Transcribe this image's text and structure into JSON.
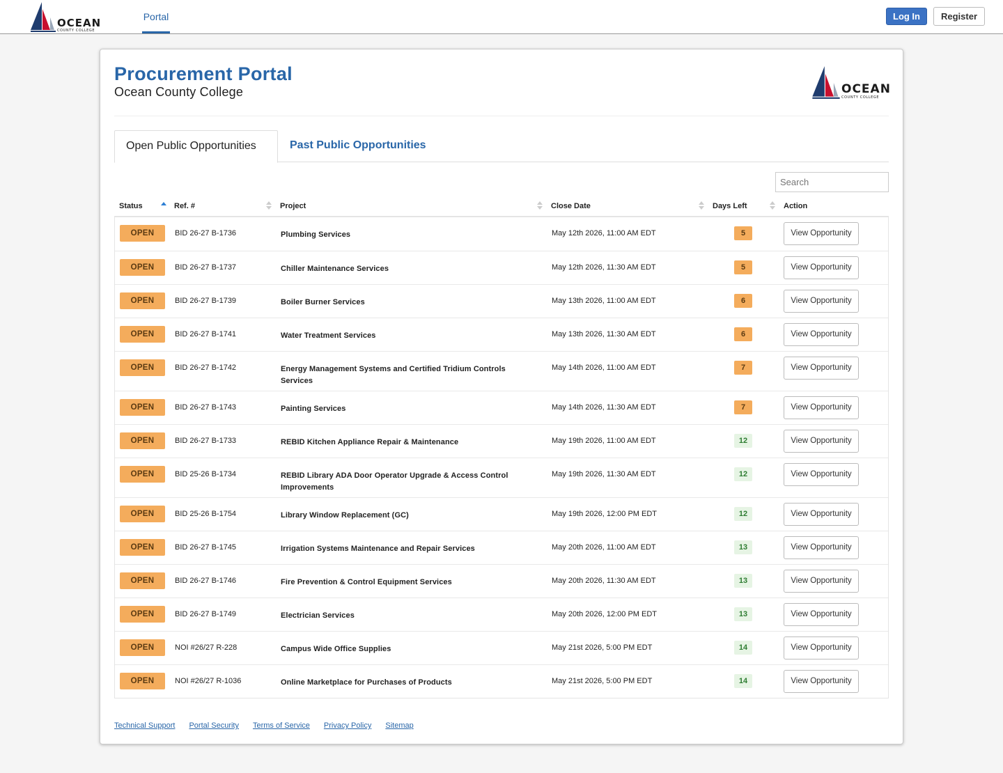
{
  "nav": {
    "logo": {
      "word": "OCEAN",
      "sub": "COUNTY COLLEGE"
    },
    "tab": "Portal",
    "login_label": "Log In",
    "register_label": "Register"
  },
  "header": {
    "title": "Procurement Portal",
    "subtitle": "Ocean County College",
    "logo": {
      "word": "OCEAN",
      "sub": "COUNTY COLLEGE"
    }
  },
  "tabs": [
    "Open Public Opportunities",
    "Past Public Opportunities"
  ],
  "search": {
    "placeholder": "Search"
  },
  "table": {
    "columns": [
      "Status",
      "Ref. #",
      "Project",
      "Close Date",
      "Days Left",
      "Action"
    ],
    "rows": [
      {
        "status": "OPEN",
        "ref": "BID 26-27 B-1736",
        "project": "Plumbing Services",
        "close": "May 12th 2026, 11:00 AM EDT",
        "days": "5",
        "tone": "orange",
        "action": "View Opportunity"
      },
      {
        "status": "OPEN",
        "ref": "BID 26-27 B-1737",
        "project": "Chiller Maintenance Services",
        "close": "May 12th 2026, 11:30 AM EDT",
        "days": "5",
        "tone": "orange",
        "action": "View Opportunity"
      },
      {
        "status": "OPEN",
        "ref": "BID 26-27 B-1739",
        "project": "Boiler Burner Services",
        "close": "May 13th 2026, 11:00 AM EDT",
        "days": "6",
        "tone": "orange",
        "action": "View Opportunity"
      },
      {
        "status": "OPEN",
        "ref": "BID 26-27 B-1741",
        "project": "Water Treatment Services",
        "close": "May 13th 2026, 11:30 AM EDT",
        "days": "6",
        "tone": "orange",
        "action": "View Opportunity"
      },
      {
        "status": "OPEN",
        "ref": "BID 26-27 B-1742",
        "project": "Energy Management Systems and Certified Tridium Controls Services",
        "close": "May 14th 2026, 11:00 AM EDT",
        "days": "7",
        "tone": "orange",
        "action": "View Opportunity",
        "tall": true
      },
      {
        "status": "OPEN",
        "ref": "BID 26-27 B-1743",
        "project": "Painting Services",
        "close": "May 14th 2026, 11:30 AM EDT",
        "days": "7",
        "tone": "orange",
        "action": "View Opportunity"
      },
      {
        "status": "OPEN",
        "ref": "BID 26-27 B-1733",
        "project": "REBID Kitchen Appliance Repair & Maintenance",
        "close": "May 19th 2026, 11:00 AM EDT",
        "days": "12",
        "tone": "green",
        "action": "View Opportunity"
      },
      {
        "status": "OPEN",
        "ref": "BID 25-26 B-1734",
        "project": "REBID Library ADA Door Operator Upgrade & Access Control Improvements",
        "close": "May 19th 2026, 11:30 AM EDT",
        "days": "12",
        "tone": "green",
        "action": "View Opportunity",
        "tall": true
      },
      {
        "status": "OPEN",
        "ref": "BID 25-26 B-1754",
        "project": "Library Window Replacement (GC)",
        "close": "May 19th 2026, 12:00 PM EDT",
        "days": "12",
        "tone": "green",
        "action": "View Opportunity"
      },
      {
        "status": "OPEN",
        "ref": "BID 26-27 B-1745",
        "project": "Irrigation Systems Maintenance and Repair Services",
        "close": "May 20th 2026, 11:00 AM EDT",
        "days": "13",
        "tone": "green",
        "action": "View Opportunity"
      },
      {
        "status": "OPEN",
        "ref": "BID 26-27 B-1746",
        "project": "Fire Prevention & Control Equipment Services",
        "close": "May 20th 2026, 11:30 AM EDT",
        "days": "13",
        "tone": "green",
        "action": "View Opportunity"
      },
      {
        "status": "OPEN",
        "ref": "BID 26-27 B-1749",
        "project": "Electrician Services",
        "close": "May 20th 2026, 12:00 PM EDT",
        "days": "13",
        "tone": "green",
        "action": "View Opportunity"
      },
      {
        "status": "OPEN",
        "ref": "NOI #26/27 R-228",
        "project": "Campus Wide Office Supplies",
        "close": "May 21st 2026, 5:00 PM EDT",
        "days": "14",
        "tone": "green",
        "action": "View Opportunity"
      },
      {
        "status": "OPEN",
        "ref": "NOI #26/27 R-1036",
        "project": "Online Marketplace for Purchases of Products",
        "close": "May 21st 2026, 5:00 PM EDT",
        "days": "14",
        "tone": "green",
        "action": "View Opportunity"
      }
    ]
  },
  "footer": {
    "links": [
      "Technical Support",
      "Portal Security",
      "Terms of Service",
      "Privacy Policy",
      "Sitemap"
    ]
  },
  "colors": {
    "brand_blue": "#2966a8",
    "badge_orange": "#f4ac5c",
    "badge_green_bg": "#e6f4e4",
    "badge_green_text": "#2e7d32"
  },
  "icons": {
    "logo": "sailboat-logo-icon",
    "sort": "sort-arrows-icon",
    "sort_asc": "sort-ascending-icon"
  }
}
